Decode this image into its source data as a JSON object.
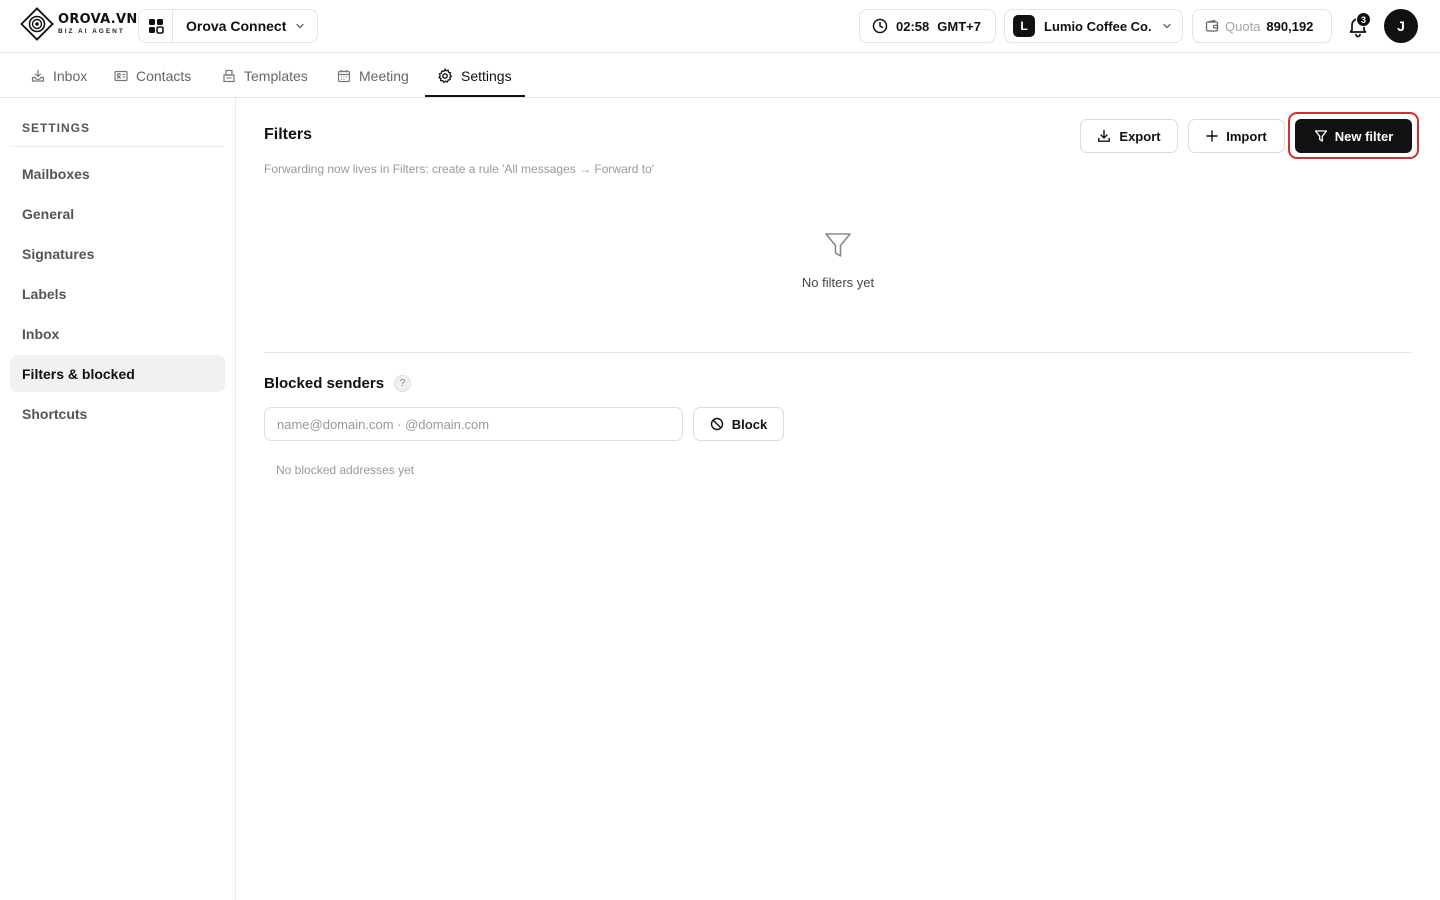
{
  "header": {
    "logo_name": "OROVA.VN",
    "logo_sub": "BIZ AI AGENT",
    "app_name": "Orova Connect",
    "time": "02:58",
    "timezone": "GMT+7",
    "org_initial": "L",
    "org_name": "Lumio Coffee Co.",
    "quota_label": "Quota",
    "quota_value": "890,192",
    "notification_count": "3",
    "avatar_initial": "J"
  },
  "tabs": [
    {
      "label": "Inbox",
      "icon": "inbox-icon"
    },
    {
      "label": "Contacts",
      "icon": "contacts-icon"
    },
    {
      "label": "Templates",
      "icon": "templates-icon"
    },
    {
      "label": "Meeting",
      "icon": "calendar-icon"
    },
    {
      "label": "Settings",
      "icon": "gear-icon",
      "active": true
    }
  ],
  "sidebar": {
    "heading": "SETTINGS",
    "items": [
      {
        "label": "Mailboxes"
      },
      {
        "label": "General"
      },
      {
        "label": "Signatures"
      },
      {
        "label": "Labels"
      },
      {
        "label": "Inbox"
      },
      {
        "label": "Filters & blocked",
        "active": true
      },
      {
        "label": "Shortcuts"
      }
    ]
  },
  "filters": {
    "title": "Filters",
    "note": "Forwarding now lives in Filters: create a rule 'All messages → Forward to'",
    "export_label": "Export",
    "import_label": "Import",
    "new_filter_label": "New filter",
    "empty_text": "No filters yet"
  },
  "blocked": {
    "title": "Blocked senders",
    "help": "?",
    "input_placeholder": "name@domain.com · @domain.com",
    "block_label": "Block",
    "empty_text": "No blocked addresses yet"
  },
  "colors": {
    "accent": "#111111",
    "highlight_border": "#d0302f"
  }
}
